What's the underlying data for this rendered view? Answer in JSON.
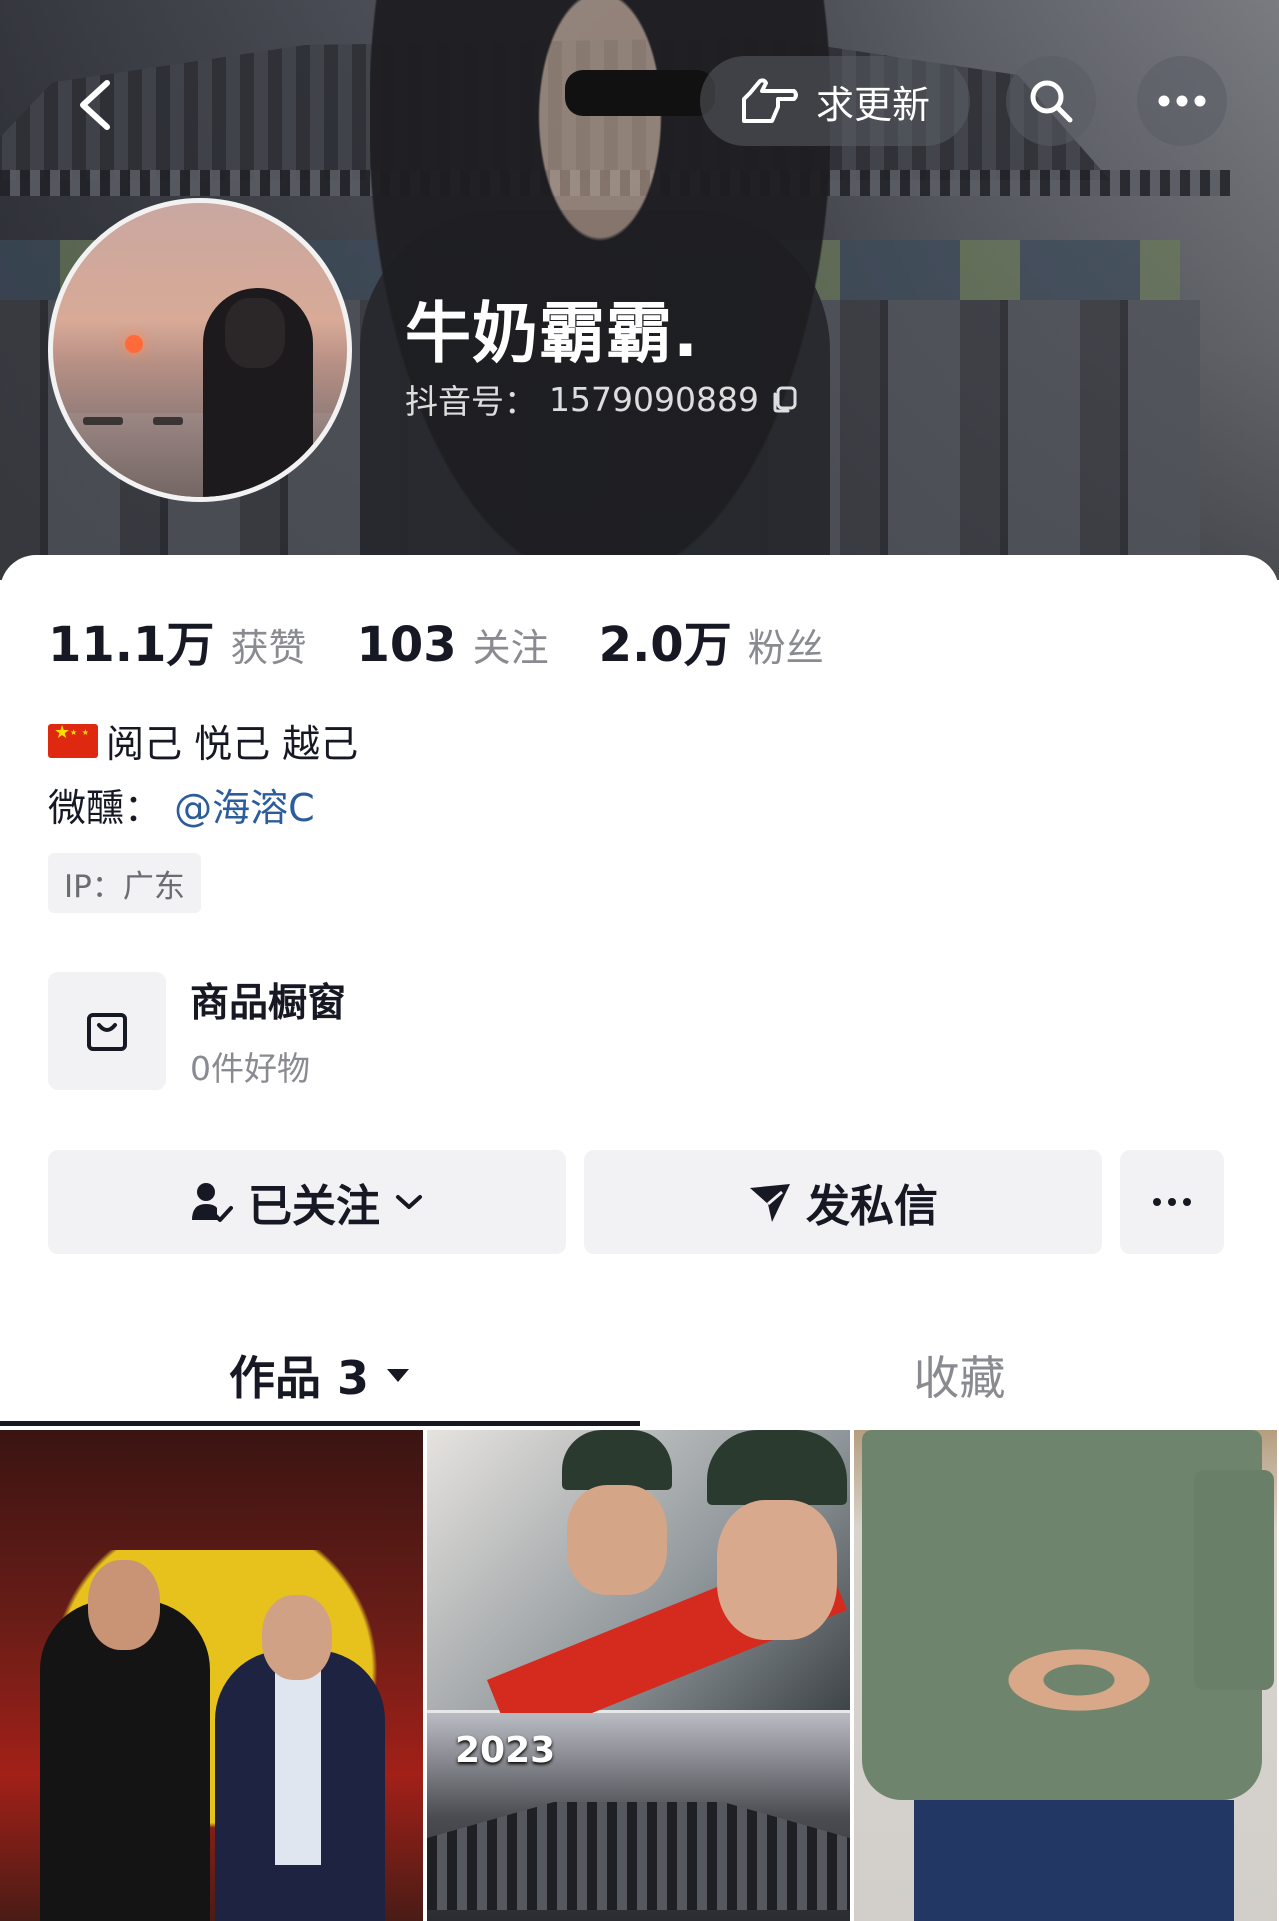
{
  "header": {
    "back_icon": "back-arrow-icon",
    "request_update": {
      "icon": "pointing-hand-icon",
      "label": "求更新"
    },
    "search_icon": "search-icon",
    "more_icon": "more-dots-icon"
  },
  "profile": {
    "username": "牛奶霸霸.",
    "douyin_id_label": "抖音号：",
    "douyin_id": "1579090889",
    "copy_icon": "copy-icon"
  },
  "stats": [
    {
      "value": "11.1万",
      "label": "获赞"
    },
    {
      "value": "103",
      "label": "关注"
    },
    {
      "value": "2.0万",
      "label": "粉丝"
    }
  ],
  "bio": {
    "flag_icon": "china-flag-icon",
    "text": "阅己 悦己 越己",
    "wechat_label": "微醺：",
    "wechat_mention": "@海溶C"
  },
  "ip_tag": "IP：广东",
  "shop": {
    "icon": "shopping-bag-icon",
    "title": "商品橱窗",
    "subtitle": "0件好物"
  },
  "actions": {
    "followed_label": "已关注",
    "followed_icon": "user-check-icon",
    "chevron_icon": "chevron-down-icon",
    "message_label": "发私信",
    "message_icon": "send-icon",
    "more_icon": "more-dots-icon"
  },
  "tabs": {
    "works_label": "作品 3",
    "works_dropdown_icon": "triangle-down-icon",
    "favorites_label": "收藏"
  },
  "grid": {
    "items": [
      {
        "kind": "photo",
        "desc_label": ""
      },
      {
        "kind": "photo",
        "overlay_text": "2023"
      },
      {
        "kind": "photo",
        "desc_label": ""
      }
    ]
  },
  "colors": {
    "text_primary": "#161823",
    "text_secondary": "#8a8b91",
    "mention_blue": "#2b5d9c",
    "button_bg": "#f2f2f4"
  }
}
